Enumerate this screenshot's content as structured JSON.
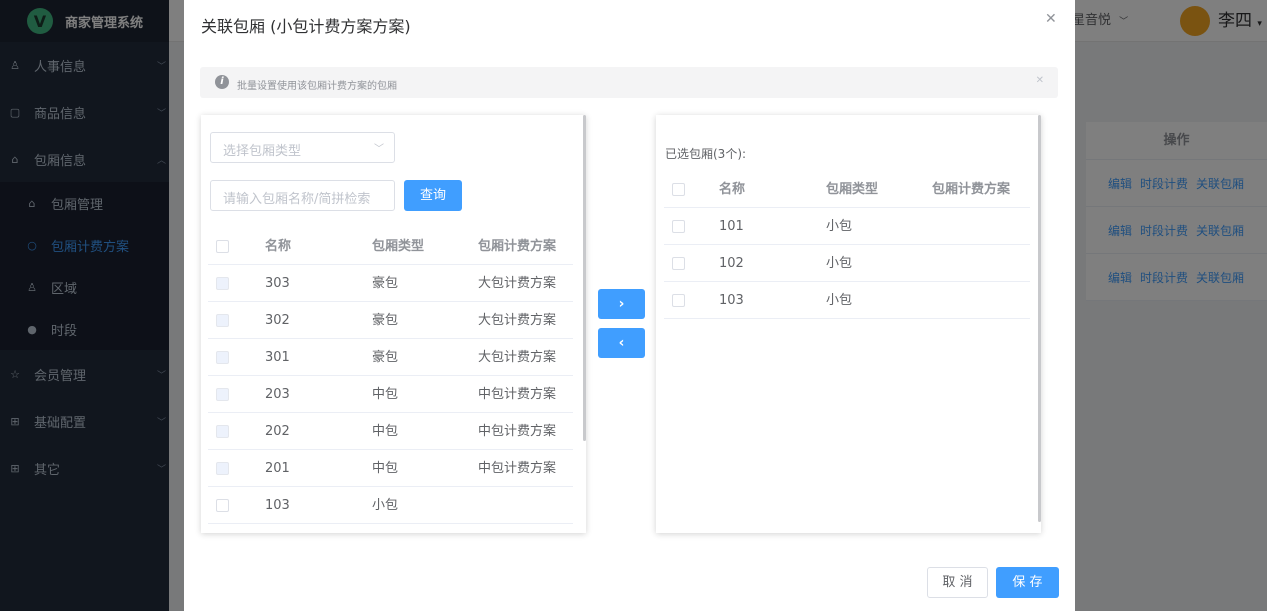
{
  "app": {
    "logo_letter": "V",
    "title": "商家管理系统"
  },
  "sidebar": {
    "menus": [
      {
        "label": "人事信息",
        "icon": "user-icon"
      },
      {
        "label": "商品信息",
        "icon": "goods-icon"
      },
      {
        "label": "包厢信息",
        "icon": "home-icon"
      },
      {
        "label": "会员管理",
        "icon": "member-icon"
      },
      {
        "label": "基础配置",
        "icon": "grid-icon"
      },
      {
        "label": "其它",
        "icon": "grid-icon"
      }
    ],
    "submenu": [
      {
        "label": "包厢管理",
        "icon": "home-icon"
      },
      {
        "label": "包厢计费方案",
        "icon": "location-icon"
      },
      {
        "label": "区域",
        "icon": "user-icon"
      },
      {
        "label": "时段",
        "icon": "clock-icon"
      }
    ]
  },
  "header": {
    "store": "星音悦",
    "user": "李四"
  },
  "background_table": {
    "header": "操作",
    "actions": [
      "编辑",
      "时段计费",
      "关联包厢"
    ]
  },
  "dialog": {
    "title": "关联包厢 (小包计费方案方案)",
    "alert": "批量设置使用该包厢计费方案的包厢",
    "left": {
      "select_placeholder": "选择包厢类型",
      "search_placeholder": "请输入包厢名称/简拼检索",
      "query_label": "查询",
      "columns": [
        "名称",
        "包厢类型",
        "包厢计费方案"
      ],
      "rows": [
        {
          "name": "303",
          "type": "豪包",
          "plan": "大包计费方案"
        },
        {
          "name": "302",
          "type": "豪包",
          "plan": "大包计费方案"
        },
        {
          "name": "301",
          "type": "豪包",
          "plan": "大包计费方案"
        },
        {
          "name": "203",
          "type": "中包",
          "plan": "中包计费方案"
        },
        {
          "name": "202",
          "type": "中包",
          "plan": "中包计费方案"
        },
        {
          "name": "201",
          "type": "中包",
          "plan": "中包计费方案"
        },
        {
          "name": "103",
          "type": "小包",
          "plan": ""
        }
      ]
    },
    "right": {
      "label": "已选包厢(3个):",
      "columns": [
        "名称",
        "包厢类型",
        "包厢计费方案"
      ],
      "rows": [
        {
          "name": "101",
          "type": "小包",
          "plan": ""
        },
        {
          "name": "102",
          "type": "小包",
          "plan": ""
        },
        {
          "name": "103",
          "type": "小包",
          "plan": ""
        }
      ]
    },
    "transfer": {
      "to_right": "›",
      "to_left": "‹"
    },
    "footer": {
      "cancel": "取 消",
      "save": "保 存"
    }
  }
}
